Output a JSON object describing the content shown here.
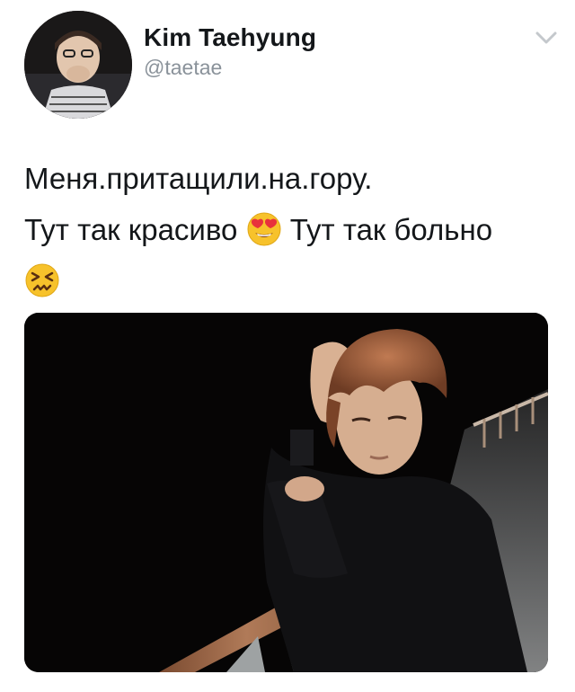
{
  "tweet": {
    "author": {
      "display_name": "Kim Taehyung",
      "handle": "@taetae"
    },
    "text_lines": [
      {
        "text": "Меня.притащили.на.гору."
      },
      {
        "text_before": "Тут так красиво",
        "emoji_1": "smiling-face-with-heart-eyes",
        "text_after": "Тут так больно"
      },
      {
        "emoji_2": "confounded-face"
      }
    ],
    "menu_icon": "chevron-down-icon",
    "media": {
      "description_icon": "photo",
      "colors": {
        "background": "#060505",
        "railing_wood": "#8a5a3c",
        "hair": "#8a5236"
      }
    }
  },
  "colors": {
    "name": "#14171a",
    "handle": "#8a929a",
    "chevron": "#c4c8cc"
  }
}
